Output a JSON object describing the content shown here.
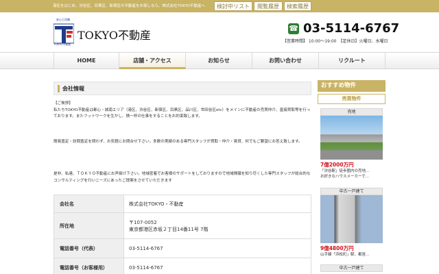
{
  "topbar": {
    "description": "港区をはじめ、渋谷区、目黒区、新宿区の不動産をお探しなら、株式会社TOKYO不動産へ",
    "buttons": [
      "検討中リスト",
      "閲覧履歴",
      "検索履歴"
    ]
  },
  "header": {
    "logo_small": "安心と信頼",
    "logo_caption": "TOKYO不動産",
    "logo_text": "TOKYO不動産",
    "phone": "03-5114-6767",
    "hours": "【営業時間】 10:00〜19:00　【定休日】火曜日、水曜日"
  },
  "nav": {
    "items": [
      "HOME",
      "店舗・アクセス",
      "お知らせ",
      "お問い合わせ",
      "リクルート"
    ]
  },
  "main": {
    "section_title": "会社情報",
    "greeting_label": "【ご挨拶】",
    "para1": "私たちTOKYO不動産は都心・城南エリア（港区、渋谷区、新宿区、目黒区、品川区、世田谷区etc）をメインに不動産の売買仲介、直接買取等を行っております。またフットワークを生かし、積一杯の仕事をすることをお約束致します。",
    "para2": "簡易査定・訪問査定を問わず、お気軽にお問合せ下さい。多数の実績のある専門スタッフが買取・仲介・賃貸、何でもご要望にお答え致します。",
    "para3": "是非、私達、ＴＯＫＹＯ不動産にお声掛け下さい。地域密着でお客様のサポートをしておりますので地域情報を知り尽くした専門スタッフが総合的なコンサルティングを行いニーズにあったご提案をさせていただきます",
    "table": [
      {
        "label": "会社名",
        "value": "株式会社TOKYO・不動産"
      },
      {
        "label": "所在地",
        "value": "〒107-0052",
        "value2": "東京都港区赤坂２丁目14番11号 7階"
      },
      {
        "label": "電話番号（代表）",
        "value": "03-5114-6767"
      },
      {
        "label": "電話番号（お客様用）",
        "value": "03-5114-6767"
      }
    ]
  },
  "sidebar": {
    "heading": "おすすめ物件",
    "subheading": "売買物件",
    "cards": [
      {
        "tag": "売地",
        "price": "7億2000万円",
        "desc1": "「渋谷駅」徒歩圏内の売地…",
        "desc2": "お好きなハウスメーカーで…"
      },
      {
        "tag": "中古一戸建て",
        "price": "9億4800万円",
        "desc1": "山手線「浜松町」駅、都営…"
      },
      {
        "tag": "中古一戸建て"
      }
    ]
  },
  "colors": {
    "accent": "#c9b364",
    "price": "#d0121b",
    "logo_blue": "#1d3c8a",
    "logo_red": "#d32f2f"
  }
}
